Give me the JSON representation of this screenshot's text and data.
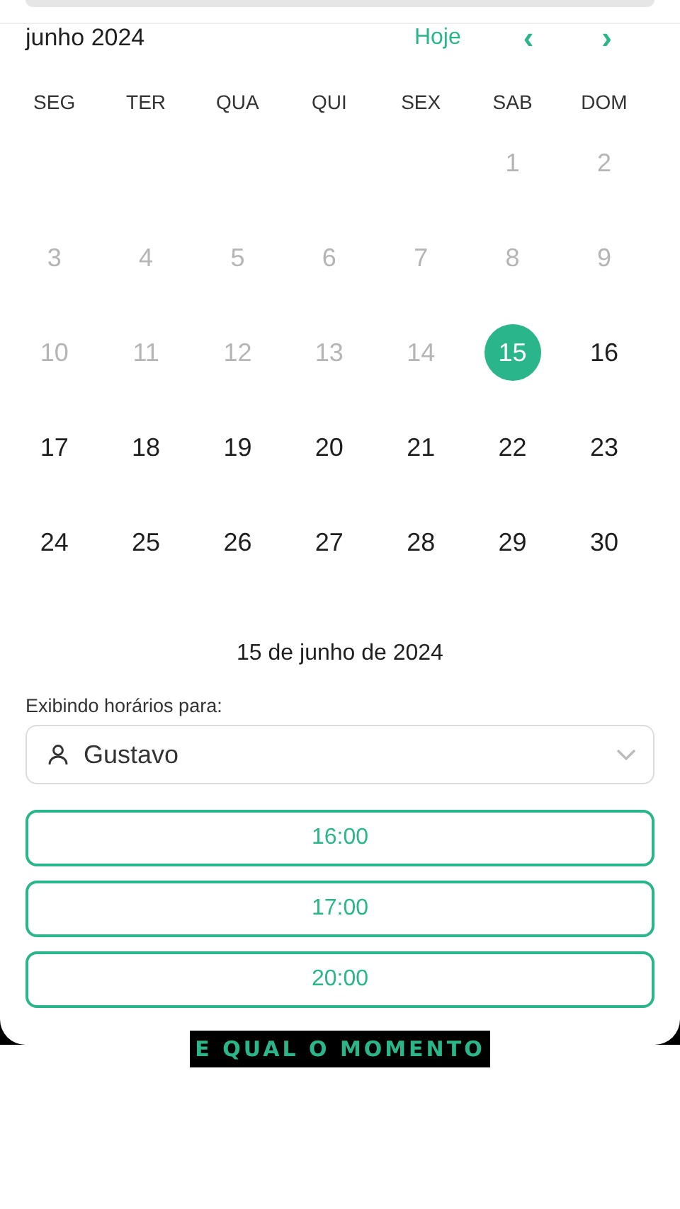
{
  "header": {
    "month": "junho 2024",
    "today": "Hoje",
    "prev": "‹",
    "next": "›"
  },
  "weekdays": [
    "SEG",
    "TER",
    "QUA",
    "QUI",
    "SEX",
    "SAB",
    "DOM"
  ],
  "weeks": [
    [
      {
        "label": "1",
        "disabled": true,
        "selected": false
      },
      {
        "label": "2",
        "disabled": true,
        "selected": false
      }
    ],
    [
      {
        "label": "3",
        "disabled": true,
        "selected": false
      },
      {
        "label": "4",
        "disabled": true,
        "selected": false
      },
      {
        "label": "5",
        "disabled": true,
        "selected": false
      },
      {
        "label": "6",
        "disabled": true,
        "selected": false
      },
      {
        "label": "7",
        "disabled": true,
        "selected": false
      },
      {
        "label": "8",
        "disabled": true,
        "selected": false
      },
      {
        "label": "9",
        "disabled": true,
        "selected": false
      }
    ],
    [
      {
        "label": "10",
        "disabled": true,
        "selected": false
      },
      {
        "label": "11",
        "disabled": true,
        "selected": false
      },
      {
        "label": "12",
        "disabled": true,
        "selected": false
      },
      {
        "label": "13",
        "disabled": true,
        "selected": false
      },
      {
        "label": "14",
        "disabled": true,
        "selected": false
      },
      {
        "label": "15",
        "disabled": false,
        "selected": true
      },
      {
        "label": "16",
        "disabled": false,
        "selected": false
      }
    ],
    [
      {
        "label": "17",
        "disabled": false,
        "selected": false
      },
      {
        "label": "18",
        "disabled": false,
        "selected": false
      },
      {
        "label": "19",
        "disabled": false,
        "selected": false
      },
      {
        "label": "20",
        "disabled": false,
        "selected": false
      },
      {
        "label": "21",
        "disabled": false,
        "selected": false
      },
      {
        "label": "22",
        "disabled": false,
        "selected": false
      },
      {
        "label": "23",
        "disabled": false,
        "selected": false
      }
    ],
    [
      {
        "label": "24",
        "disabled": false,
        "selected": false
      },
      {
        "label": "25",
        "disabled": false,
        "selected": false
      },
      {
        "label": "26",
        "disabled": false,
        "selected": false
      },
      {
        "label": "27",
        "disabled": false,
        "selected": false
      },
      {
        "label": "28",
        "disabled": false,
        "selected": false
      },
      {
        "label": "29",
        "disabled": false,
        "selected": false
      },
      {
        "label": "30",
        "disabled": false,
        "selected": false
      }
    ]
  ],
  "selected_date": "15 de junho de 2024",
  "professional": {
    "label": "Exibindo horários para:",
    "value": "Gustavo"
  },
  "slots": [
    "16:00",
    "17:00",
    "20:00"
  ],
  "caption": "E QUAL O MOMENTO"
}
